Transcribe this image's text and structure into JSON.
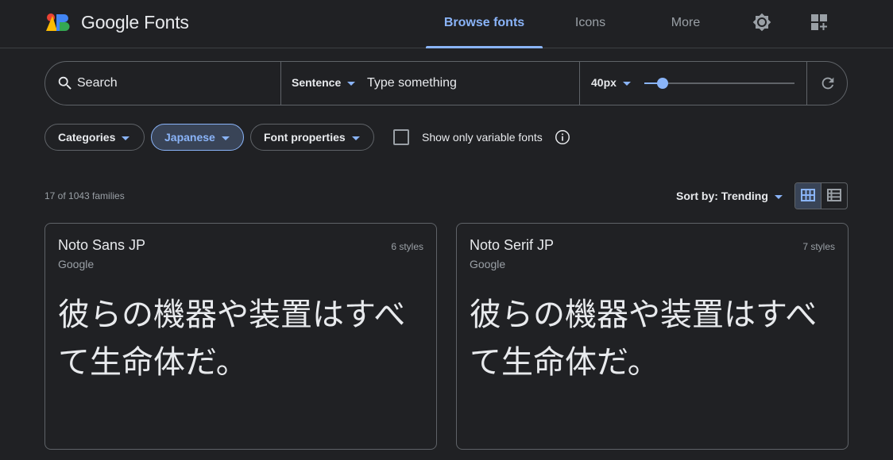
{
  "brand": {
    "name": "Google Fonts"
  },
  "nav": {
    "items": [
      {
        "label": "Browse fonts",
        "active": true
      },
      {
        "label": "Icons",
        "active": false
      },
      {
        "label": "More",
        "active": false
      }
    ]
  },
  "search": {
    "placeholder": "Search",
    "preview_mode": "Sentence",
    "preview_placeholder": "Type something",
    "size_label": "40px",
    "size_slider_fraction": 0.12
  },
  "filters": {
    "categories_label": "Categories",
    "language_label": "Japanese",
    "properties_label": "Font properties",
    "variable_label": "Show only variable fonts",
    "variable_checked": false
  },
  "results": {
    "count_text": "17 of 1043 families",
    "sort_label": "Sort by: Trending",
    "view_mode": "grid"
  },
  "cards": [
    {
      "name": "Noto Sans JP",
      "foundry": "Google",
      "styles": "6 styles",
      "sample": "彼らの機器や装置はすべて生命体だ。"
    },
    {
      "name": "Noto Serif JP",
      "foundry": "Google",
      "styles": "7 styles",
      "sample": "彼らの機器や装置はすべて生命体だ。"
    }
  ],
  "colors": {
    "background": "#202124",
    "accent": "#8ab4f8",
    "border": "#5f6368",
    "text": "#e8eaed",
    "muted": "#9aa0a6"
  },
  "icons": {
    "logo": "google-fonts-logo",
    "theme": "brightness-icon",
    "apps": "apps-add-icon",
    "search": "search-icon",
    "reset": "refresh-icon",
    "info": "info-icon",
    "grid": "grid-view-icon",
    "list": "list-view-icon"
  }
}
